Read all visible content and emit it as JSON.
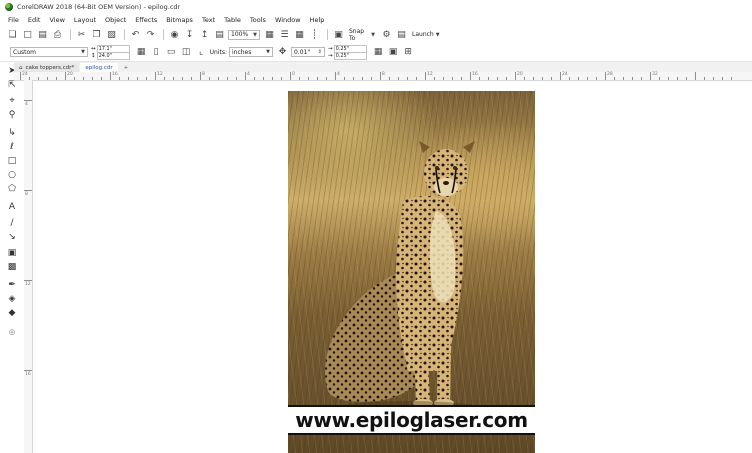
{
  "window": {
    "title": "CorelDRAW 2018 (64-Bit OEM Version) - epilog.cdr"
  },
  "menu": {
    "items": [
      "File",
      "Edit",
      "View",
      "Layout",
      "Object",
      "Effects",
      "Bitmaps",
      "Text",
      "Table",
      "Tools",
      "Window",
      "Help"
    ]
  },
  "toolbar": {
    "zoom_value": "100%",
    "snap_to_label": "Snap To",
    "launch_label": "Launch"
  },
  "propbar": {
    "page_preset": "Custom",
    "page_width": "17.1\"",
    "page_height": "24.0\"",
    "units_label": "Units:",
    "units_value": "inches",
    "nudge_value": "0.01\"",
    "dup_x": "0.25\"",
    "dup_y": "0.25\""
  },
  "doc_tabs": [
    "cake toppers.cdr*",
    "epilog.cdr"
  ],
  "photo": {
    "watermark": "www.epiloglaser.com"
  },
  "ruler": {
    "h_labels": [
      "24",
      "20",
      "16",
      "12",
      "8",
      "4",
      "0",
      "4",
      "8",
      "12",
      "16",
      "20",
      "24",
      "28",
      "32"
    ],
    "v_labels": [
      "4",
      "8",
      "12",
      "16"
    ]
  }
}
